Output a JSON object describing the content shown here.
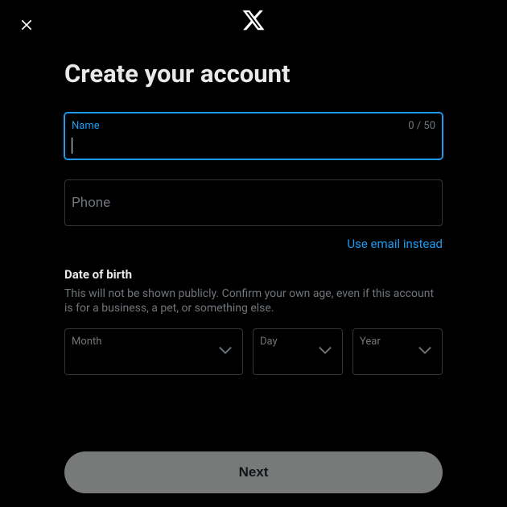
{
  "header": {},
  "title": "Create your account",
  "fields": {
    "name": {
      "label": "Name",
      "counter": "0 / 50",
      "value": ""
    },
    "phone": {
      "label": "Phone",
      "value": ""
    }
  },
  "link": {
    "email": "Use email instead"
  },
  "dob": {
    "title": "Date of birth",
    "description": "This will not be shown publicly. Confirm your own age, even if this account is for a business, a pet, or something else.",
    "month": {
      "label": "Month"
    },
    "day": {
      "label": "Day"
    },
    "year": {
      "label": "Year"
    }
  },
  "buttons": {
    "next": "Next"
  }
}
